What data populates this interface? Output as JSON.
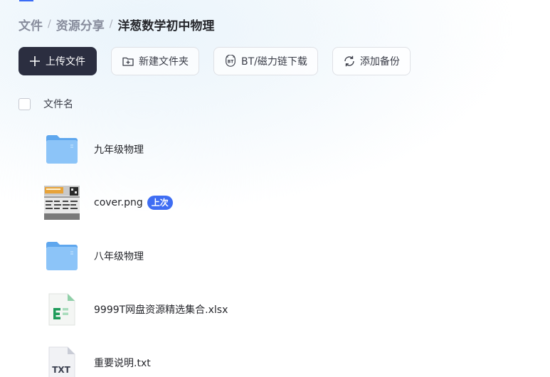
{
  "breadcrumb": {
    "items": [
      "文件",
      "资源分享"
    ],
    "separator": "/",
    "current": "洋葱数学初中物理"
  },
  "toolbar": {
    "upload_label": "上传文件",
    "new_folder_label": "新建文件夹",
    "bt_label": "BT/磁力链下载",
    "backup_label": "添加备份"
  },
  "list_header": {
    "name_column": "文件名"
  },
  "files": [
    {
      "name": "九年级物理",
      "icon": "folder-icon"
    },
    {
      "name": "cover.png",
      "icon": "image-thumbnail",
      "badge": "上次"
    },
    {
      "name": "八年级物理",
      "icon": "folder-icon"
    },
    {
      "name": "9999T网盘资源精选集合.xlsx",
      "icon": "excel-file-icon"
    },
    {
      "name": "重要说明.txt",
      "icon": "txt-file-icon"
    }
  ],
  "colors": {
    "primary_button": "#2b2e40",
    "badge": "#3e6df3",
    "folder": "#7ab8f5",
    "excel": "#1e9b5a"
  }
}
